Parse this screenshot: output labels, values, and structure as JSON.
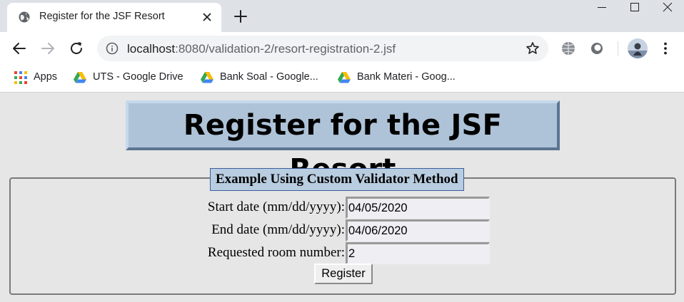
{
  "browser": {
    "tab": {
      "title": "Register for the JSF Resort",
      "favicon": "globe-icon"
    },
    "toolbar": {
      "url_host": "localhost",
      "url_rest": ":8080/validation-2/resort-registration-2.jsf"
    },
    "bookmarks": [
      {
        "label": "Apps",
        "icon": "apps-grid-icon"
      },
      {
        "label": "UTS - Google Drive",
        "icon": "google-drive-icon"
      },
      {
        "label": "Bank Soal - Google...",
        "icon": "google-drive-icon"
      },
      {
        "label": "Bank Materi - Goog...",
        "icon": "google-drive-icon"
      }
    ]
  },
  "page": {
    "heading": "Register for the JSF Resort",
    "form": {
      "legend": "Example Using Custom Validator Method",
      "fields": [
        {
          "label": "Start date (mm/dd/yyyy):",
          "value": "04/05/2020"
        },
        {
          "label": "End date (mm/dd/yyyy):",
          "value": "04/06/2020"
        },
        {
          "label": "Requested room number:",
          "value": "2"
        }
      ],
      "submit_label": "Register"
    }
  },
  "colors": {
    "heading_bg": "#aec3d8",
    "legend_bg": "#b9cde0",
    "legend_border": "#3b5e9b",
    "page_bg": "#e6e6e6"
  }
}
